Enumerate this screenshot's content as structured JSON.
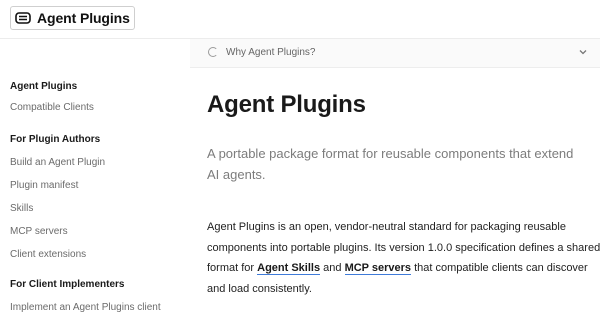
{
  "header": {
    "brand_name": "Agent Plugins",
    "brand_icon": "plug-icon"
  },
  "sidebar": {
    "items": [
      {
        "label": "Agent Plugins",
        "kind": "section"
      },
      {
        "label": "Compatible Clients",
        "kind": "link"
      },
      {
        "label": "For Plugin Authors",
        "kind": "section"
      },
      {
        "label": "Build an Agent Plugin",
        "kind": "link"
      },
      {
        "label": "Plugin manifest",
        "kind": "link"
      },
      {
        "label": "Skills",
        "kind": "link"
      },
      {
        "label": "MCP servers",
        "kind": "link"
      },
      {
        "label": "Client extensions",
        "kind": "link"
      },
      {
        "label": "For Client Implementers",
        "kind": "section"
      },
      {
        "label": "Implement an Agent Plugins client",
        "kind": "link"
      }
    ]
  },
  "main": {
    "collapsible": {
      "label": "Why Agent Plugins?",
      "icon": "spinner-icon",
      "expanded": false
    },
    "title": "Agent Plugins",
    "subtitle": "A portable package format for reusable components that extend AI agents.",
    "body": {
      "before_link1": "Agent Plugins is an open, vendor-neutral standard for packaging reusable components into portable plugins. Its version 1.0.0 specification defines a shared format for ",
      "link1": "Agent Skills",
      "between_links": " and ",
      "link2": "MCP servers",
      "after_link2": " that compatible clients can discover and load consistently."
    }
  },
  "colors": {
    "link_underline": "#3f7bd9",
    "muted_text": "#7c7c7c",
    "primary_text": "#1a1a1a"
  }
}
